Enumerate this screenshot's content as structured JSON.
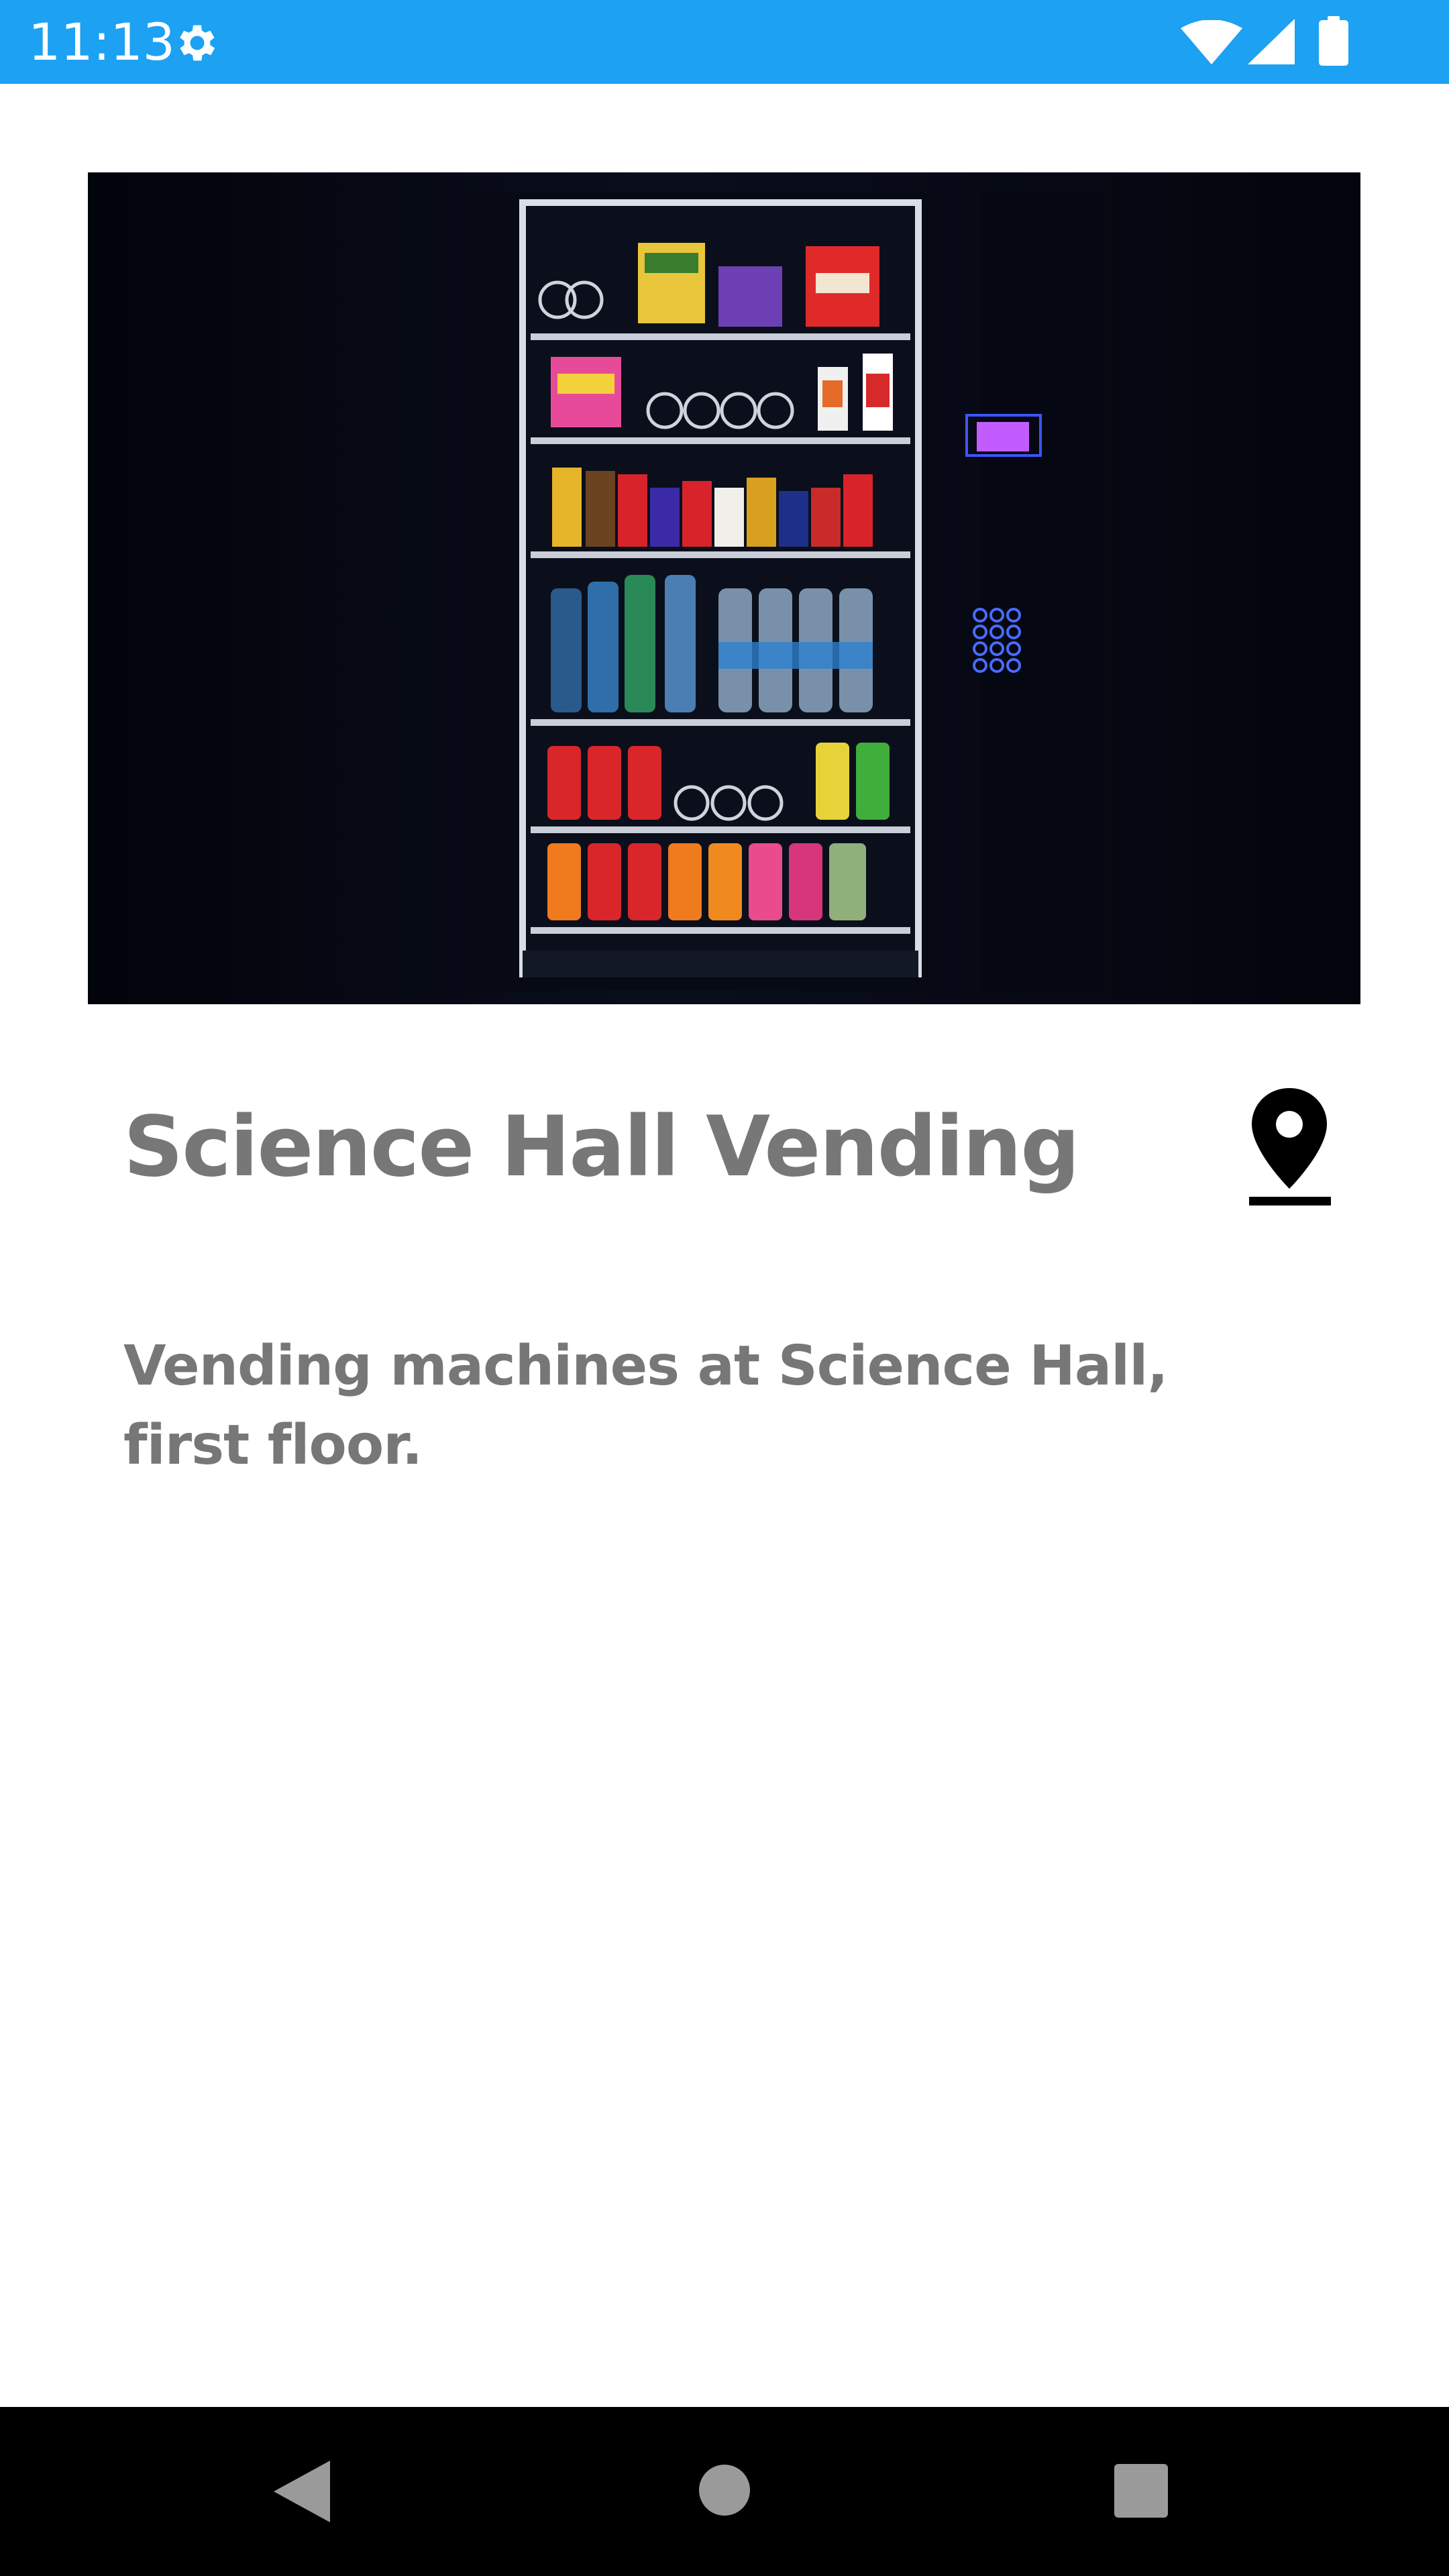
{
  "status_bar": {
    "time": "11:13",
    "background_color": "#1da1f2",
    "icons": [
      "gear-icon",
      "wifi-icon",
      "signal-icon",
      "battery-icon"
    ]
  },
  "hero_image": {
    "subject": "vending machine"
  },
  "detail": {
    "title": "Science Hall Vending",
    "description": "Vending machines at Science Hall, first floor.",
    "location_button_icon": "map-pin-icon"
  },
  "nav_bar": {
    "buttons": [
      "back-icon",
      "home-icon",
      "recents-icon"
    ]
  },
  "colors": {
    "text": "#777777",
    "accent": "#1da1f2"
  }
}
